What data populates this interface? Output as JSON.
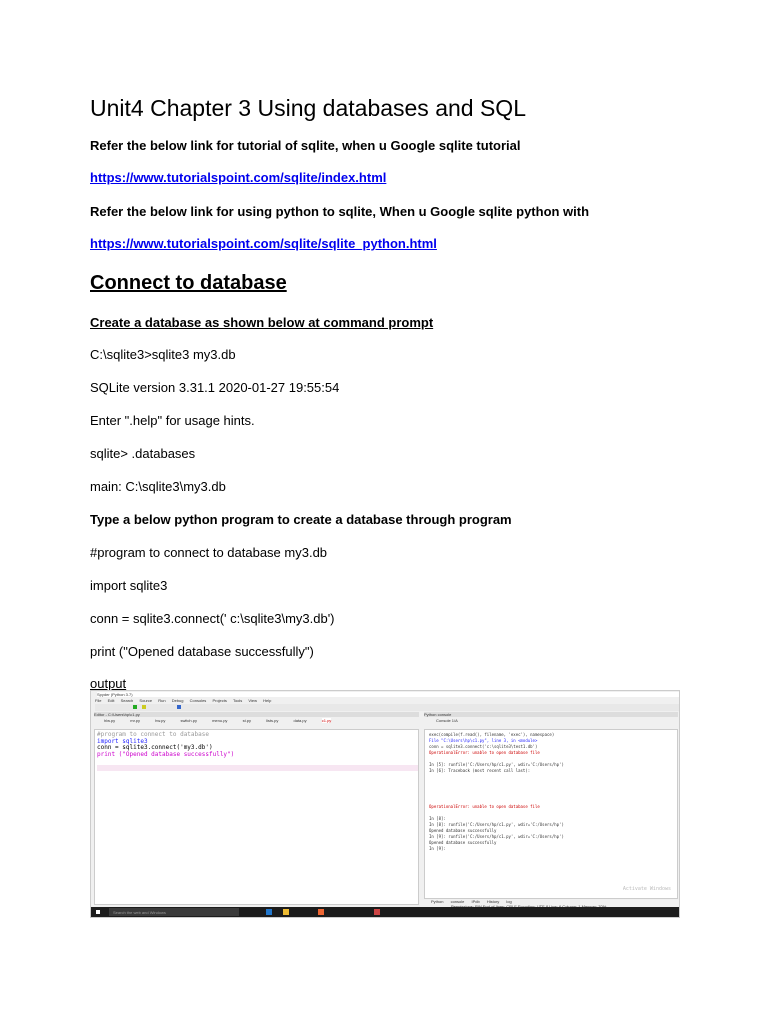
{
  "title": "Unit4  Chapter 3 Using databases and SQL",
  "intro": [
    {
      "text": "Refer the below  link for tutorial of sqlite, when u Google sqlite tutorial"
    },
    {
      "link": "https://www.tutorialspoint.com/sqlite/index.html"
    },
    {
      "text": "Refer the below link for using python to sqlite, When u Google sqlite python with"
    },
    {
      "link": "https://www.tutorialspoint.com/sqlite/sqlite_python.html"
    }
  ],
  "section_heading": "Connect to database",
  "subheading": "Create a database as shown below at command prompt",
  "prompt_lines": [
    "C:\\sqlite3>sqlite3 my3.db",
    "SQLite version 3.31.1 2020-01-27 19:55:54",
    "Enter \".help\" for usage hints.",
    "sqlite> .databases",
    "main: C:\\sqlite3\\my3.db"
  ],
  "program_heading": "Type a below python program to create a database through program",
  "program_lines": [
    "#program to connect to database my3.db",
    "import sqlite3",
    "conn = sqlite3.connect(' c:\\sqlite3\\my3.db')",
    "print (\"Opened database successfully\")"
  ],
  "output_label": "output",
  "screenshot": {
    "window_title": "Spyder (Python 3.7)",
    "menu": [
      "File",
      "Edit",
      "Search",
      "Source",
      "Run",
      "Debug",
      "Consoles",
      "Projects",
      "Tools",
      "View",
      "Help"
    ],
    "editor_path": "Editor - C:\\Users\\hp\\c1.py",
    "tabs": [
      "hlw.py",
      "mr.py",
      "hw.py",
      "switch.py",
      "menu.py",
      "st.py",
      "lists.py",
      "data.py",
      "c1.py"
    ],
    "code": [
      "#program to connect to database",
      "import sqlite3",
      "conn = sqlite3.connect('my3.db')",
      "print (\"Opened database successfully\")",
      "",
      ""
    ],
    "console_title": "Python console",
    "console_tab": "Console 1/A",
    "console_lines": [
      "exec(compile(f.read(), filename, 'exec'), namespace)",
      "File \"C:\\Users\\hp\\c1.py\", line 3, in <module>",
      "conn = sqlite3.connect('c:\\sqlite3\\test1.db')",
      "OperationalError: unable to open database file",
      "In [5]: runfile('C:/Users/hp/c1.py', wdir='C:/Users/hp')",
      "In [6]: Traceback (most recent call last):",
      "OperationalError: unable to open database file",
      "In [8]:",
      "In [8]: runfile('C:/Users/hp/c1.py', wdir='C:/Users/hp')",
      "Opened database successfully",
      "In [9]: runfile('C:/Users/hp/c1.py', wdir='C:/Users/hp')",
      "Opened database successfully",
      "In [9]:"
    ],
    "activate": "Activate Windows",
    "console_bottom_tabs": [
      "Python console",
      "IPdb",
      "History log"
    ],
    "status": "Permissions: RW   End-of-lines: CRLF   Encoding: UTF-8   Line: 6   Column: 1   Memory: 70%",
    "taskbar_search": "Search the web and Windows",
    "colors": {
      "string": "#2aa02a",
      "keyword": "#cc00cc",
      "error": "#cc0000"
    }
  }
}
